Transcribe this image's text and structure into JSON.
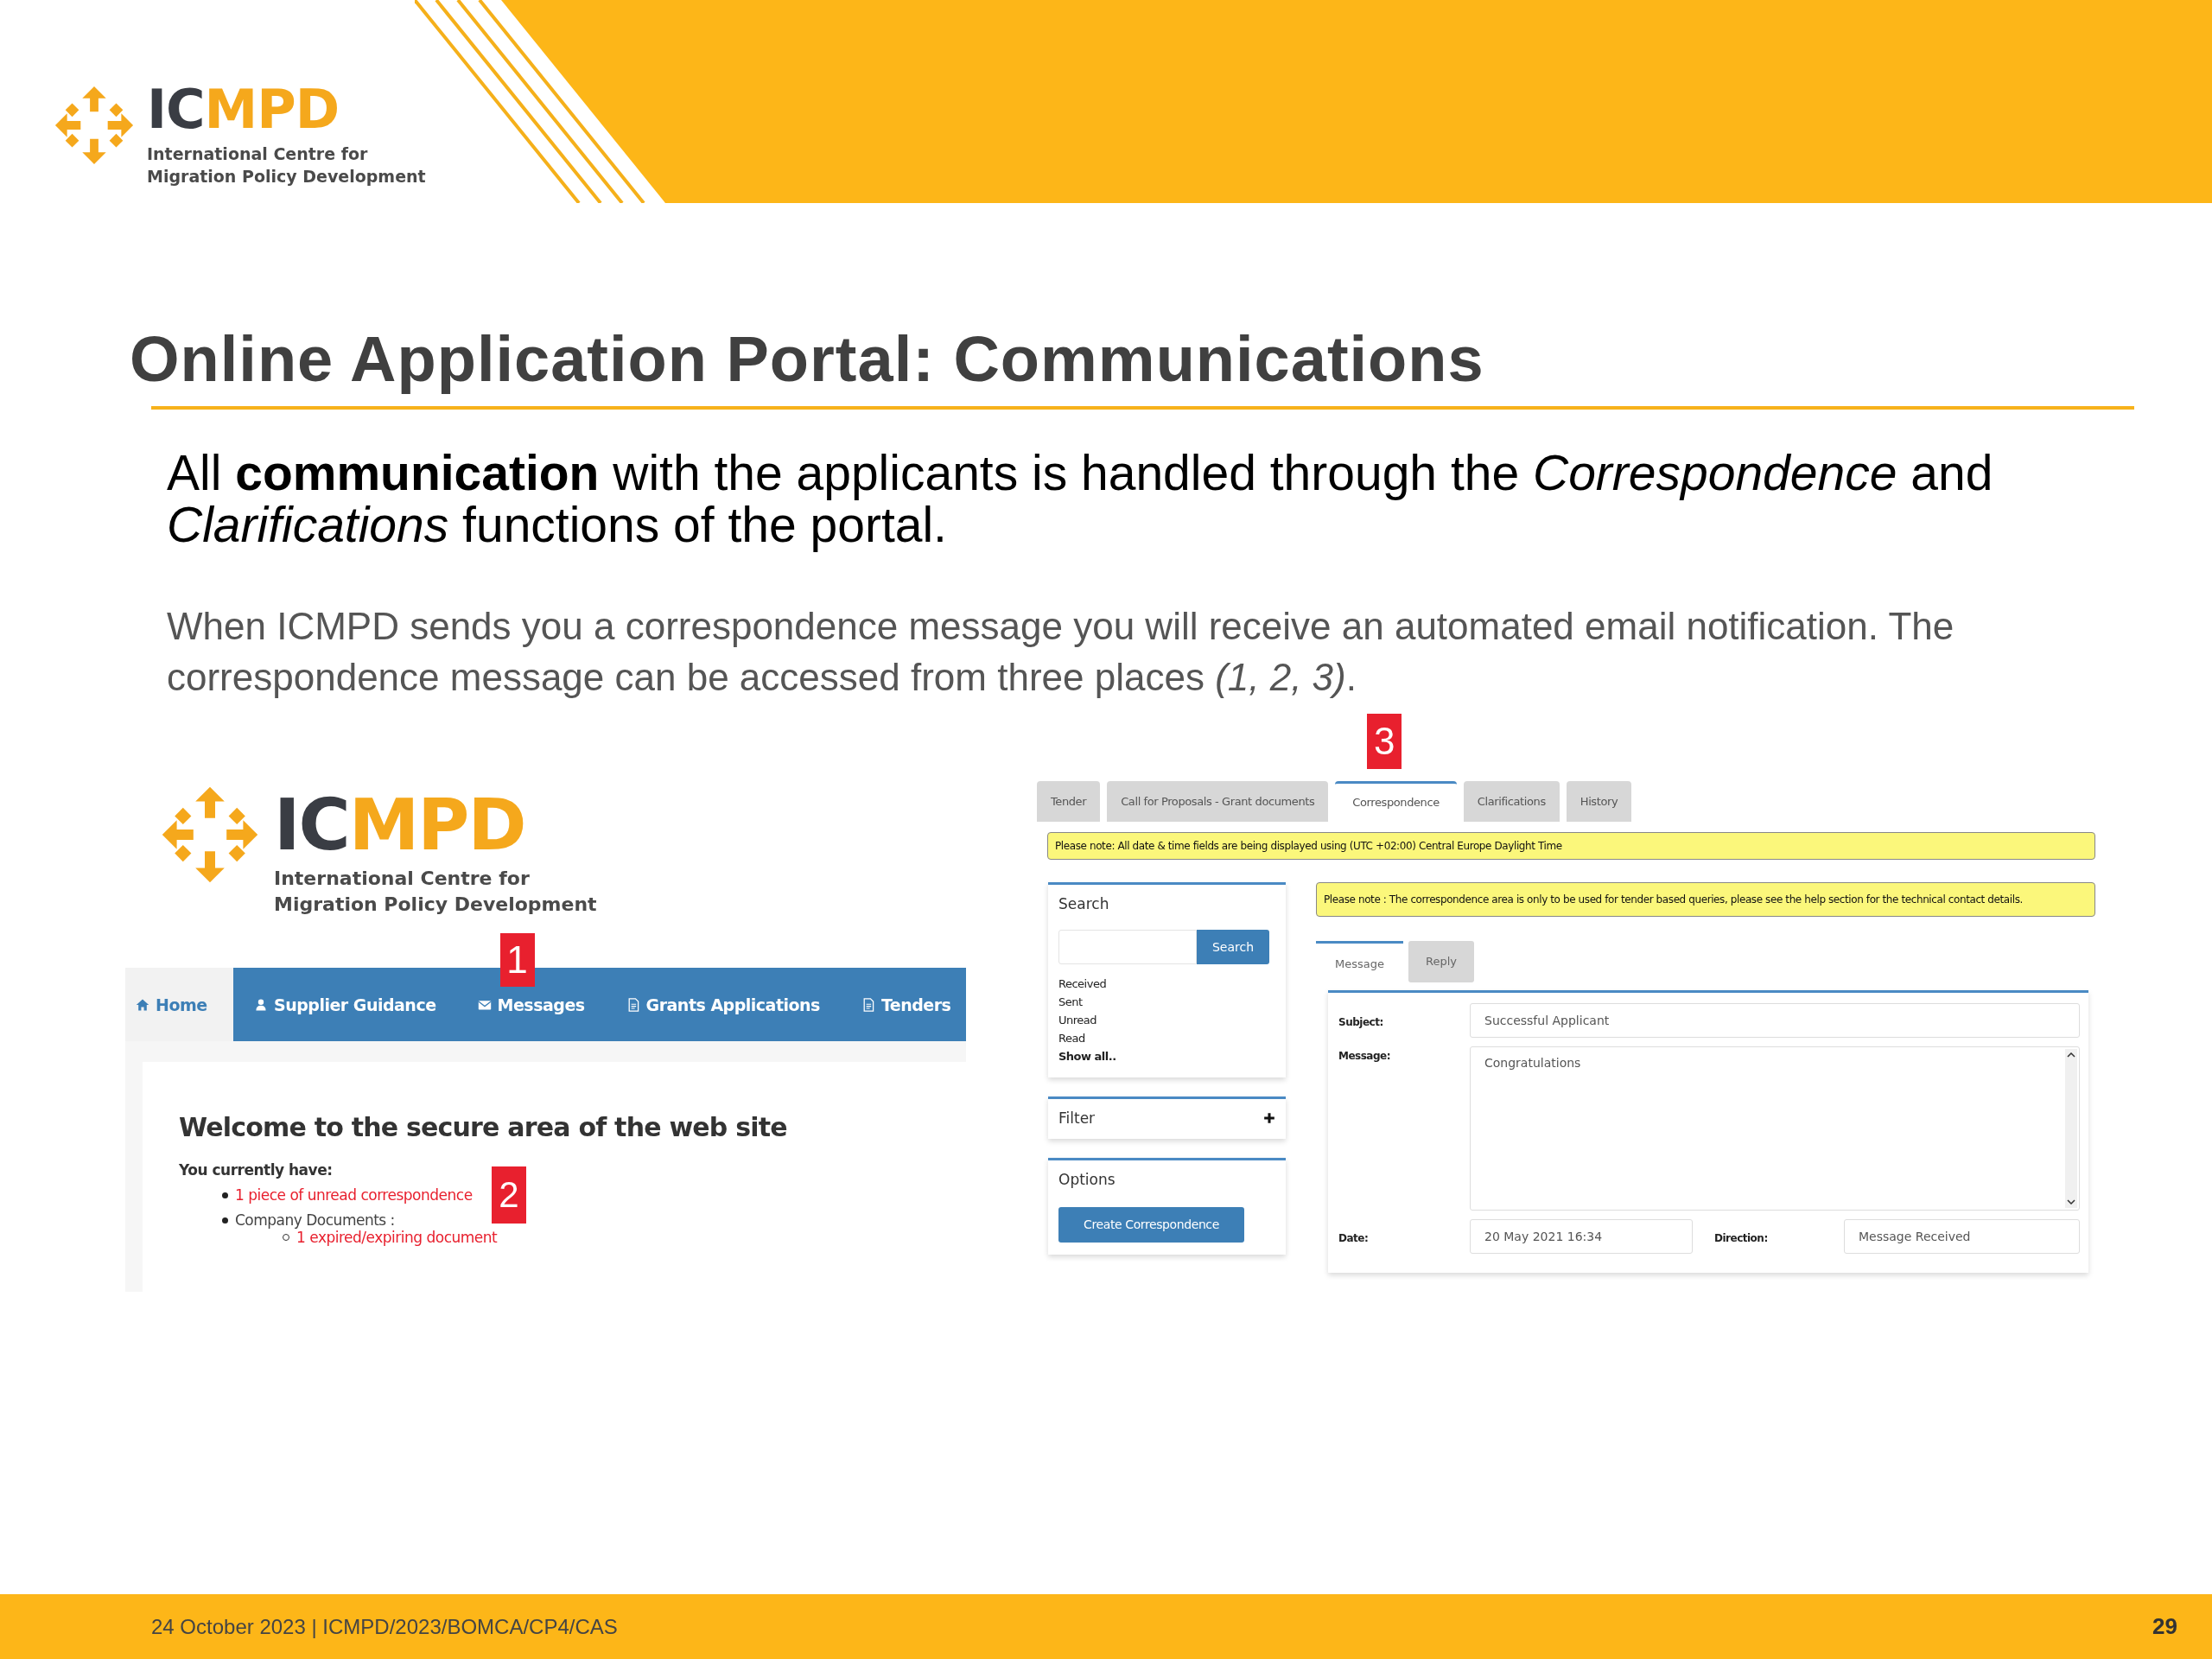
{
  "header": {
    "logo": {
      "wordmark_dark": "IC",
      "wordmark_accent": "MPD",
      "tagline": [
        "International Centre for",
        "Migration Policy Development"
      ]
    }
  },
  "title": "Online Application Portal: Communications",
  "intro": "All **communication** with the applicants is handled through the *Correspondence* and *Clarifications* functions of the portal.",
  "body": "When ICMPD sends you a correspondence message you will receive an automated email notification. The correspondence message can be accessed from three places *(1, 2, 3)*.",
  "portal_home": {
    "logo": {
      "wordmark_dark": "IC",
      "wordmark_accent": "MPD",
      "tagline": [
        "International Centre for",
        "Migration Policy Development"
      ]
    },
    "nav": [
      {
        "label": "Home",
        "selected": true
      },
      {
        "label": "Supplier Guidance",
        "selected": false
      },
      {
        "label": "Messages",
        "selected": false,
        "marker": "1"
      },
      {
        "label": "Grants Applications",
        "selected": false
      },
      {
        "label": "Tenders",
        "selected": false
      }
    ],
    "heading": "Welcome to the secure area of the web site",
    "summary_label": "You currently have:",
    "items": [
      {
        "text": "1 piece of unread correspondence",
        "kind": "link",
        "marker": "2"
      },
      {
        "text": "Company Documents :",
        "kind": "text",
        "children": [
          {
            "text": "1 expired/expiring document",
            "kind": "link"
          }
        ]
      }
    ]
  },
  "correspondence_page": {
    "tabs": [
      {
        "label": "Tender",
        "selected": false
      },
      {
        "label": "Call for Proposals - Grant documents",
        "selected": false
      },
      {
        "label": "Correspondence",
        "selected": true,
        "marker": "3"
      },
      {
        "label": "Clarifications",
        "selected": false
      },
      {
        "label": "History",
        "selected": false
      }
    ],
    "timezone_notice": "Please note: All date & time fields are being displayed using (UTC +02:00) Central Europe Daylight Time",
    "search_panel": {
      "title": "Search",
      "button": "Search",
      "filters": [
        {
          "label": "Received",
          "bold": false
        },
        {
          "label": "Sent",
          "bold": false
        },
        {
          "label": "Unread",
          "bold": false
        },
        {
          "label": "Read",
          "bold": false
        },
        {
          "label": "Show all..",
          "bold": true
        }
      ]
    },
    "filter_panel": {
      "title": "Filter"
    },
    "options_panel": {
      "title": "Options",
      "button": "Create Correspondence"
    },
    "note": "Please note : The correspondence area is only to be used for tender based queries, please see the help section for the technical contact details.",
    "message_tabs": [
      {
        "label": "Message",
        "selected": true
      },
      {
        "label": "Reply",
        "selected": false
      }
    ],
    "form": {
      "subject_label": "Subject:",
      "subject": "Successful Applicant",
      "message_label": "Message:",
      "message": "Congratulations",
      "date_label": "Date:",
      "date": "20 May 2021 16:34",
      "direction_label": "Direction:",
      "direction": "Message Received"
    }
  },
  "footer": {
    "text": "24 October 2023 | ICMPD/2023/BOMCA/CP4/CAS",
    "page_number": "29"
  }
}
